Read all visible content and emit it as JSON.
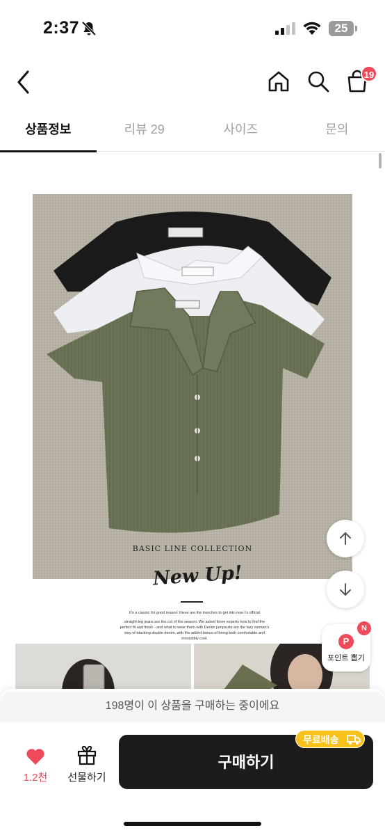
{
  "status_bar": {
    "time": "2:37",
    "battery": "25"
  },
  "header": {
    "cart_badge": "19"
  },
  "tabs": [
    {
      "label": "상품정보",
      "active": true
    },
    {
      "label": "리뷰 29",
      "active": false
    },
    {
      "label": "사이즈",
      "active": false
    },
    {
      "label": "문의",
      "active": false
    }
  ],
  "product": {
    "image_caption": "BASIC LINE COLLECTION",
    "headline": "New Up!",
    "intro": "It's a classic for good reason' these are the trenches to get into now t's official",
    "description": "straight-leg jeans are the cut of the season. We asked three experts how to find the perfect fit and finish - and what to wear them with Denim jumpsuits are the lazy woman's way of tdacking double denim, with the added bonus of being both comfortable and irresistibly cool."
  },
  "floating": {
    "point_label": "포인트 뽑기",
    "point_p": "P",
    "point_new": "N"
  },
  "bottom": {
    "buyers_text": "198명이 이 상품을 구매하는 중이에요",
    "like_count": "1.2천",
    "gift_label": "선물하기",
    "buy_label": "구매하기",
    "shipping_badge": "무료배송"
  },
  "colors": {
    "accent": "#ef4a5a",
    "shipping": "#f7c21b",
    "buy_button": "#1c1c1c"
  },
  "icons": [
    "bell-slash-icon",
    "signal-icon",
    "wifi-icon",
    "back-icon",
    "home-icon",
    "search-icon",
    "cart-icon",
    "arrow-up-icon",
    "arrow-down-icon",
    "heart-icon",
    "gift-icon",
    "truck-icon"
  ]
}
